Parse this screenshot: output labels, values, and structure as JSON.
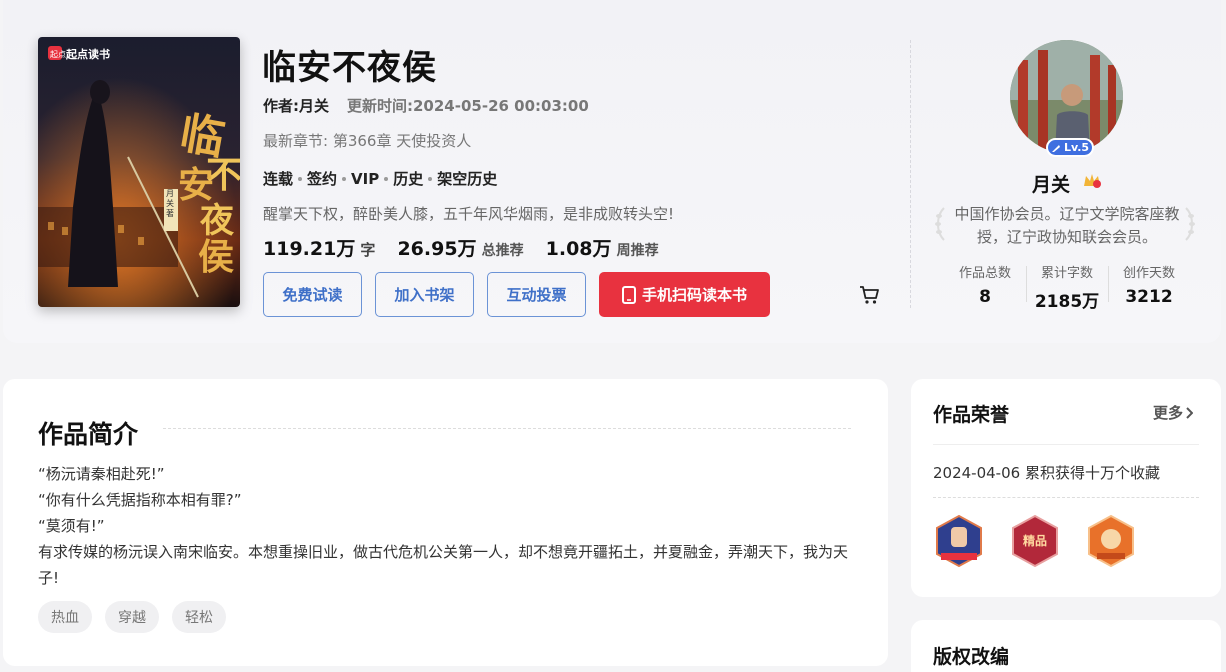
{
  "book": {
    "title": "临安不夜侯",
    "author_label": "作者:月关",
    "updated": "更新时间:2024-05-26 00:03:00",
    "latest_chapter": "最新章节: 第366章 天使投资人",
    "tags": [
      "连载",
      "签约",
      "VIP",
      "历史",
      "架空历史"
    ],
    "summary_line": "醒掌天下权，醉卧美人膝，五千年风华烟雨，是非成败转头空!",
    "cover_brand": "起点读书",
    "cover_title_chars": "临安不夜侯",
    "cover_author": "月关著",
    "stats": [
      {
        "num": "119.21万",
        "unit": "字"
      },
      {
        "num": "26.95万",
        "unit": "总推荐"
      },
      {
        "num": "1.08万",
        "unit": "周推荐"
      }
    ]
  },
  "actions": {
    "free_read": "免费试读",
    "add_shelf": "加入书架",
    "vote": "互动投票",
    "scan_read": "手机扫码读本书"
  },
  "author": {
    "level": "Lv.5",
    "name": "月关",
    "desc": "中国作协会员。辽宁文学院客座教授，辽宁政协知联会会员。",
    "stats": [
      {
        "label": "作品总数",
        "value": "8"
      },
      {
        "label": "累计字数",
        "value": "2185万"
      },
      {
        "label": "创作天数",
        "value": "3212"
      }
    ]
  },
  "intro_section": {
    "title": "作品简介",
    "lines": [
      "“杨沅请秦相赴死!”",
      "“你有什么凭据指称本相有罪?”",
      "“莫须有!”",
      "有求传媒的杨沅误入南宋临安。本想重操旧业，做古代危机公关第一人，却不想竟开疆拓土，并夏融金，弄潮天下，我为天子!"
    ],
    "tags": [
      "热血",
      "穿越",
      "轻松"
    ]
  },
  "honors": {
    "title": "作品荣誉",
    "more": "更多",
    "item": "2024-04-06 累积获得十万个收藏"
  },
  "copyright": {
    "title": "版权改编"
  },
  "colors": {
    "accent_red": "#e8323f",
    "link_blue": "#3f70c8",
    "level_blue": "#3f6fe0"
  }
}
